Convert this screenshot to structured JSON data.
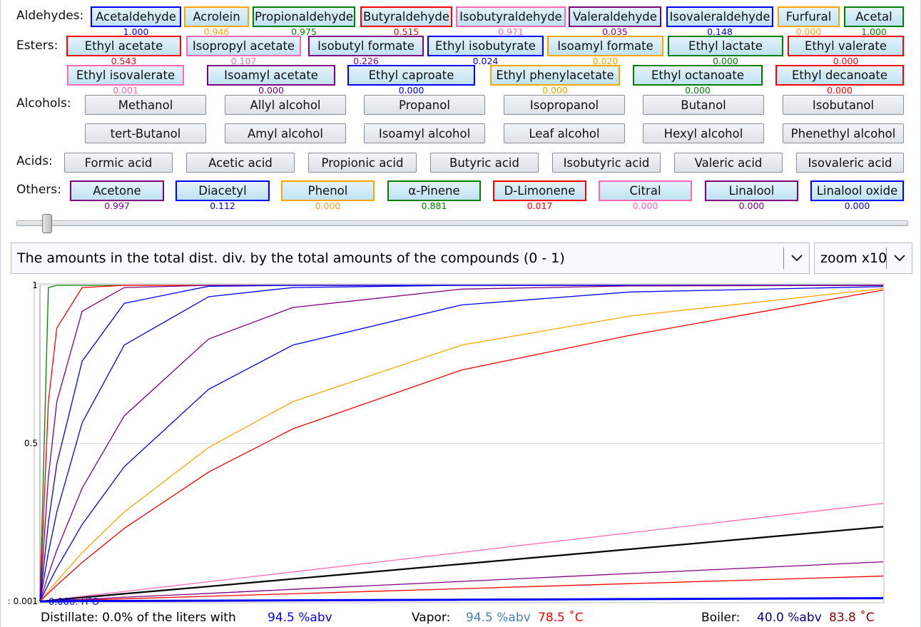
{
  "colors": {
    "blue": "#0000ff",
    "orange": "#ffa500",
    "green": "#008000",
    "red": "#ff0000",
    "pink": "#ff69b4",
    "purple": "#800080",
    "black": "#000000"
  },
  "groups": {
    "aldehydes": {
      "label": "Aldehydes:",
      "items": [
        {
          "name": "Acetaldehyde",
          "value": "1.000",
          "color": "blue"
        },
        {
          "name": "Acrolein",
          "value": "0.946",
          "color": "orange"
        },
        {
          "name": "Propionaldehyde",
          "value": "0.975",
          "color": "green"
        },
        {
          "name": "Butyraldehyde",
          "value": "0.515",
          "color": "red"
        },
        {
          "name": "Isobutyraldehyde",
          "value": "0.971",
          "color": "pink"
        },
        {
          "name": "Valeraldehyde",
          "value": "0.035",
          "color": "purple"
        },
        {
          "name": "Isovaleraldehyde",
          "value": "0.148",
          "color": "blue"
        },
        {
          "name": "Furfural",
          "value": "0.000",
          "color": "orange"
        },
        {
          "name": "Acetal",
          "value": "1.000",
          "color": "green"
        }
      ]
    },
    "esters": {
      "label": "Esters:",
      "items": [
        {
          "name": "Ethyl acetate",
          "value": "0.543",
          "color": "red"
        },
        {
          "name": "Isopropyl acetate",
          "value": "0.107",
          "color": "pink"
        },
        {
          "name": "Isobutyl formate",
          "value": "0.226",
          "color": "purple"
        },
        {
          "name": "Ethyl isobutyrate",
          "value": "0.024",
          "color": "blue"
        },
        {
          "name": "Isoamyl formate",
          "value": "0.020",
          "color": "orange"
        },
        {
          "name": "Ethyl lactate",
          "value": "0.000",
          "color": "green"
        },
        {
          "name": "Ethyl valerate",
          "value": "0.000",
          "color": "red"
        },
        {
          "name": "Ethyl isovalerate",
          "value": "0.001",
          "color": "pink"
        },
        {
          "name": "Isoamyl acetate",
          "value": "0.000",
          "color": "purple"
        },
        {
          "name": "Ethyl caproate",
          "value": "0.000",
          "color": "blue"
        },
        {
          "name": "Ethyl phenylacetate",
          "value": "0.000",
          "color": "orange"
        },
        {
          "name": "Ethyl octanoate",
          "value": "0.000",
          "color": "green"
        },
        {
          "name": "Ethyl decanoate",
          "value": "0.000",
          "color": "red"
        }
      ]
    },
    "alcohols": {
      "label": "Alcohols:",
      "items": [
        "Methanol",
        "Allyl alcohol",
        "Propanol",
        "Isopropanol",
        "Butanol",
        "Isobutanol",
        "tert-Butanol",
        "Amyl alcohol",
        "Isoamyl alcohol",
        "Leaf alcohol",
        "Hexyl alcohol",
        "Phenethyl alcohol"
      ]
    },
    "acids": {
      "label": "Acids:",
      "items": [
        "Formic acid",
        "Acetic acid",
        "Propionic acid",
        "Butyric acid",
        "Isobutyric acid",
        "Valeric acid",
        "Isovaleric acid"
      ]
    },
    "others": {
      "label": "Others:",
      "items": [
        {
          "name": "Acetone",
          "value": "0.997",
          "color": "purple"
        },
        {
          "name": "Diacetyl",
          "value": "0.112",
          "color": "blue"
        },
        {
          "name": "Phenol",
          "value": "0.000",
          "color": "orange"
        },
        {
          "name": "α-Pinene",
          "value": "0.881",
          "color": "green"
        },
        {
          "name": "D-Limonene",
          "value": "0.017",
          "color": "red"
        },
        {
          "name": "Citral",
          "value": "0.000",
          "color": "pink"
        },
        {
          "name": "Linalool",
          "value": "0.000",
          "color": "purple"
        },
        {
          "name": "Linalool oxide",
          "value": "0.000",
          "color": "blue"
        }
      ]
    }
  },
  "slider": {
    "value": 0.035
  },
  "mode_select": {
    "value": "The amounts in the total dist. div. by the total amounts of the compounds (0 - 1)"
  },
  "zoom_select": {
    "value": "zoom x10"
  },
  "chart_data": {
    "type": "line",
    "ylim": [
      0,
      1
    ],
    "y_ticks": [
      "1",
      "0.5",
      ": 0.001"
    ],
    "bottom_label": "0.000: H²O",
    "grid": true,
    "x": [
      0,
      0.01,
      0.02,
      0.05,
      0.1,
      0.2,
      0.3,
      0.5,
      0.7,
      1.0
    ],
    "series": [
      {
        "color": "green",
        "values": [
          0,
          0.993,
          1,
          1,
          1,
          1,
          1,
          1,
          1,
          1
        ]
      },
      {
        "color": "red",
        "values": [
          0,
          0.632,
          0.865,
          0.993,
          1,
          1,
          1,
          1,
          1,
          1
        ]
      },
      {
        "color": "purple",
        "values": [
          0,
          0.393,
          0.632,
          0.918,
          0.993,
          1,
          1,
          1,
          1,
          1
        ]
      },
      {
        "color": "blue",
        "values": [
          0,
          0.249,
          0.435,
          0.76,
          0.943,
          0.997,
          1,
          1,
          1,
          1
        ]
      },
      {
        "color": "blue",
        "values": [
          0,
          0.154,
          0.283,
          0.565,
          0.811,
          0.964,
          0.993,
          1,
          1,
          1
        ]
      },
      {
        "color": "purple",
        "values": [
          0,
          0.085,
          0.162,
          0.358,
          0.587,
          0.83,
          0.93,
          0.988,
          0.998,
          1
        ]
      },
      {
        "color": "blue",
        "values": [
          0,
          0.054,
          0.105,
          0.243,
          0.426,
          0.671,
          0.811,
          0.938,
          0.979,
          0.996
        ]
      },
      {
        "color": "orange",
        "values": [
          0,
          0.033,
          0.064,
          0.154,
          0.283,
          0.487,
          0.632,
          0.811,
          0.903,
          0.99
        ]
      },
      {
        "color": "red",
        "values": [
          0,
          0.026,
          0.051,
          0.123,
          0.231,
          0.409,
          0.546,
          0.732,
          0.842,
          0.985
        ]
      },
      {
        "color": "pink",
        "values": [
          0,
          0.003,
          0.006,
          0.016,
          0.031,
          0.062,
          0.093,
          0.155,
          0.217,
          0.31
        ]
      },
      {
        "color": "black",
        "values": [
          0,
          0.002,
          0.005,
          0.012,
          0.024,
          0.047,
          0.071,
          0.118,
          0.165,
          0.236
        ]
      },
      {
        "color": "purple",
        "values": [
          0,
          0.001,
          0.003,
          0.006,
          0.013,
          0.025,
          0.038,
          0.063,
          0.088,
          0.125
        ]
      },
      {
        "color": "red",
        "values": [
          0,
          0.001,
          0.002,
          0.004,
          0.008,
          0.016,
          0.024,
          0.04,
          0.056,
          0.08
        ]
      },
      {
        "color": "blue",
        "values": [
          0,
          0,
          0,
          0.001,
          0.001,
          0.002,
          0.003,
          0.005,
          0.007,
          0.01
        ]
      }
    ]
  },
  "footer": {
    "distillate_label": "Distillate: 0.0% of the liters with",
    "distillate_abv": "94.5 %abv",
    "vapor_label": "Vapor:",
    "vapor_abv": "94.5 %abv",
    "vapor_temp": "78.5 ˚C",
    "boiler_label": "Boiler:",
    "boiler_abv": "40.0 %abv",
    "boiler_temp": "83.8 ˚C"
  }
}
